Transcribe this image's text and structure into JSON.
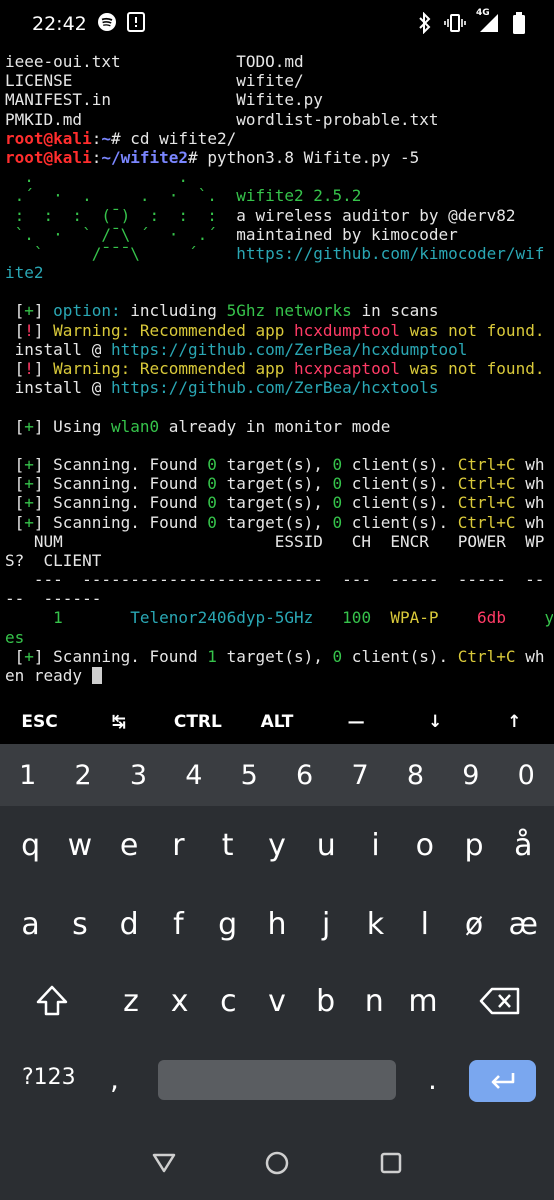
{
  "status_bar": {
    "time": "22:42",
    "network": "4G",
    "icons": [
      "spotify-icon",
      "notification-icon",
      "bluetooth-icon",
      "vibrate-icon",
      "signal-icon",
      "battery-icon"
    ]
  },
  "terminal": {
    "lines": [
      [
        {
          "t": "ieee-oui.txt            TODO.md",
          "c": "white"
        }
      ],
      [
        {
          "t": "LICENSE                 wifite/",
          "c": "white"
        }
      ],
      [
        {
          "t": "MANIFEST.in             Wifite.py",
          "c": "white"
        }
      ],
      [
        {
          "t": "PMKID.md                wordlist-probable.txt",
          "c": "white"
        }
      ],
      [
        {
          "t": "root@kali",
          "c": "red"
        },
        {
          "t": ":",
          "c": "white"
        },
        {
          "t": "~",
          "c": "blue"
        },
        {
          "t": "# cd wifite2/",
          "c": "white"
        }
      ],
      [
        {
          "t": "root@kali",
          "c": "red"
        },
        {
          "t": ":",
          "c": "white"
        },
        {
          "t": "~/wifite2",
          "c": "blue"
        },
        {
          "t": "# python3.8 Wifite.py -5",
          "c": "white"
        }
      ],
      [
        {
          "t": "  .               .",
          "c": "green"
        }
      ],
      [
        {
          "t": " .´  ·  .     .  ·  `.  ",
          "c": "green"
        },
        {
          "t": "wifite2 ",
          "c": "green"
        },
        {
          "t": "2.5.2",
          "c": "green"
        }
      ],
      [
        {
          "t": " :  :  :  (¯)  :  :  :  ",
          "c": "green"
        },
        {
          "t": "a wireless auditor by @derv82",
          "c": "white"
        }
      ],
      [
        {
          "t": " `.  ·  ` /¯\\ ´  ·  .´  ",
          "c": "green"
        },
        {
          "t": "maintained by kimocoder",
          "c": "white"
        }
      ],
      [
        {
          "t": "   `     /¯¯¯\\     ´    ",
          "c": "green"
        },
        {
          "t": "https://github.com/kimocoder/wif",
          "c": "cyan"
        }
      ],
      [
        {
          "t": "ite2",
          "c": "cyan"
        }
      ],
      [
        {
          "t": "",
          "c": "white"
        }
      ],
      [
        {
          "t": " [",
          "c": "white"
        },
        {
          "t": "+",
          "c": "green"
        },
        {
          "t": "] ",
          "c": "white"
        },
        {
          "t": "option:",
          "c": "cyan"
        },
        {
          "t": " including ",
          "c": "white"
        },
        {
          "t": "5Ghz networks",
          "c": "green"
        },
        {
          "t": " in scans",
          "c": "white"
        }
      ],
      [
        {
          "t": " [",
          "c": "white"
        },
        {
          "t": "!",
          "c": "magenta"
        },
        {
          "t": "] ",
          "c": "white"
        },
        {
          "t": "Warning: Recommended app ",
          "c": "yellow"
        },
        {
          "t": "hcxdumptool",
          "c": "magenta"
        },
        {
          "t": " was not found.",
          "c": "yellow"
        }
      ],
      [
        {
          "t": " install @ ",
          "c": "white"
        },
        {
          "t": "https://github.com/ZerBea/hcxdumptool",
          "c": "cyan"
        }
      ],
      [
        {
          "t": " [",
          "c": "white"
        },
        {
          "t": "!",
          "c": "magenta"
        },
        {
          "t": "] ",
          "c": "white"
        },
        {
          "t": "Warning: Recommended app ",
          "c": "yellow"
        },
        {
          "t": "hcxpcaptool",
          "c": "magenta"
        },
        {
          "t": " was not found.",
          "c": "yellow"
        }
      ],
      [
        {
          "t": " install @ ",
          "c": "white"
        },
        {
          "t": "https://github.com/ZerBea/hcxtools",
          "c": "cyan"
        }
      ],
      [
        {
          "t": "",
          "c": "white"
        }
      ],
      [
        {
          "t": " [",
          "c": "white"
        },
        {
          "t": "+",
          "c": "green"
        },
        {
          "t": "] Using ",
          "c": "white"
        },
        {
          "t": "wlan0",
          "c": "green"
        },
        {
          "t": " already in monitor mode",
          "c": "white"
        }
      ],
      [
        {
          "t": "",
          "c": "white"
        }
      ],
      [
        {
          "t": " [",
          "c": "white"
        },
        {
          "t": "+",
          "c": "green"
        },
        {
          "t": "] Scanning. Found ",
          "c": "white"
        },
        {
          "t": "0",
          "c": "green"
        },
        {
          "t": " target(s), ",
          "c": "white"
        },
        {
          "t": "0",
          "c": "green"
        },
        {
          "t": " client(s). ",
          "c": "white"
        },
        {
          "t": "Ctrl+C",
          "c": "yellow"
        },
        {
          "t": " wh",
          "c": "white"
        }
      ],
      [
        {
          "t": " [",
          "c": "white"
        },
        {
          "t": "+",
          "c": "green"
        },
        {
          "t": "] Scanning. Found ",
          "c": "white"
        },
        {
          "t": "0",
          "c": "green"
        },
        {
          "t": " target(s), ",
          "c": "white"
        },
        {
          "t": "0",
          "c": "green"
        },
        {
          "t": " client(s). ",
          "c": "white"
        },
        {
          "t": "Ctrl+C",
          "c": "yellow"
        },
        {
          "t": " wh",
          "c": "white"
        }
      ],
      [
        {
          "t": " [",
          "c": "white"
        },
        {
          "t": "+",
          "c": "green"
        },
        {
          "t": "] Scanning. Found ",
          "c": "white"
        },
        {
          "t": "0",
          "c": "green"
        },
        {
          "t": " target(s), ",
          "c": "white"
        },
        {
          "t": "0",
          "c": "green"
        },
        {
          "t": " client(s). ",
          "c": "white"
        },
        {
          "t": "Ctrl+C",
          "c": "yellow"
        },
        {
          "t": " wh",
          "c": "white"
        }
      ],
      [
        {
          "t": " [",
          "c": "white"
        },
        {
          "t": "+",
          "c": "green"
        },
        {
          "t": "] Scanning. Found ",
          "c": "white"
        },
        {
          "t": "0",
          "c": "green"
        },
        {
          "t": " target(s), ",
          "c": "white"
        },
        {
          "t": "0",
          "c": "green"
        },
        {
          "t": " client(s). ",
          "c": "white"
        },
        {
          "t": "Ctrl+C",
          "c": "yellow"
        },
        {
          "t": " wh",
          "c": "white"
        }
      ],
      [
        {
          "t": "   NUM                      ESSID   CH  ENCR   POWER  WP",
          "c": "white"
        }
      ],
      [
        {
          "t": "S?  CLIENT",
          "c": "white"
        }
      ],
      [
        {
          "t": "   ---  -------------------------  ---  -----  -----  --",
          "c": "white"
        }
      ],
      [
        {
          "t": "--  ------",
          "c": "white"
        }
      ],
      [
        {
          "t": "     1       ",
          "c": "green"
        },
        {
          "t": "Telenor2406dyp-5GHz",
          "c": "cyan"
        },
        {
          "t": "   ",
          "c": "white"
        },
        {
          "t": "100",
          "c": "green"
        },
        {
          "t": "  ",
          "c": "white"
        },
        {
          "t": "WPA-P",
          "c": "yellow"
        },
        {
          "t": "    ",
          "c": "white"
        },
        {
          "t": "6db",
          "c": "magenta"
        },
        {
          "t": "    ",
          "c": "white"
        },
        {
          "t": "y",
          "c": "green"
        }
      ],
      [
        {
          "t": "es",
          "c": "green"
        }
      ],
      [
        {
          "t": " [",
          "c": "white"
        },
        {
          "t": "+",
          "c": "green"
        },
        {
          "t": "] Scanning. Found ",
          "c": "white"
        },
        {
          "t": "1",
          "c": "green"
        },
        {
          "t": " target(s), ",
          "c": "white"
        },
        {
          "t": "0",
          "c": "green"
        },
        {
          "t": " client(s). ",
          "c": "white"
        },
        {
          "t": "Ctrl+C",
          "c": "yellow"
        },
        {
          "t": " wh",
          "c": "white"
        }
      ],
      [
        {
          "t": "en ready ",
          "c": "white"
        }
      ]
    ]
  },
  "extra_keys": [
    {
      "label": "ESC",
      "name": "esc-key"
    },
    {
      "label": "↹",
      "name": "tab-key"
    },
    {
      "label": "CTRL",
      "name": "ctrl-key"
    },
    {
      "label": "ALT",
      "name": "alt-key"
    },
    {
      "label": "—",
      "name": "dash-key"
    },
    {
      "label": "↓",
      "name": "down-arrow-key"
    },
    {
      "label": "↑",
      "name": "up-arrow-key"
    }
  ],
  "keyboard": {
    "numbers": [
      "1",
      "2",
      "3",
      "4",
      "5",
      "6",
      "7",
      "8",
      "9",
      "0"
    ],
    "row1": [
      "q",
      "w",
      "e",
      "r",
      "t",
      "y",
      "u",
      "i",
      "o",
      "p",
      "å"
    ],
    "row2": [
      "a",
      "s",
      "d",
      "f",
      "g",
      "h",
      "j",
      "k",
      "l",
      "ø",
      "æ"
    ],
    "row3": [
      "z",
      "x",
      "c",
      "v",
      "b",
      "n",
      "m"
    ],
    "symbols_label": "?123",
    "comma": ",",
    "period": ".",
    "enter_color": "#7aa7ef"
  },
  "colors": {
    "terminal_bg": "#000000",
    "keyboard_bg": "#2b2e32",
    "number_row_bg": "#3a3d41"
  }
}
